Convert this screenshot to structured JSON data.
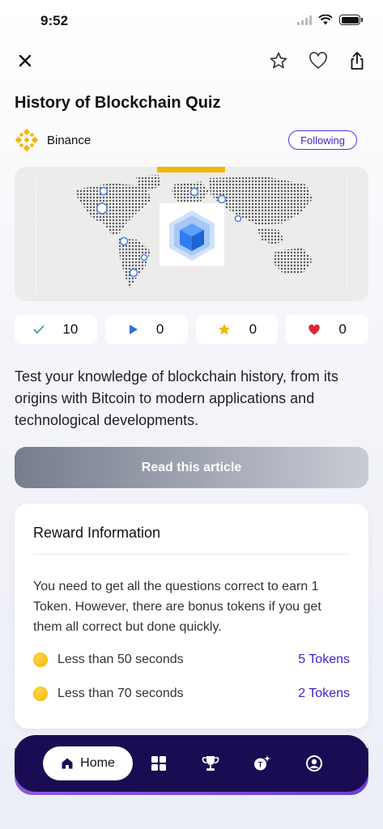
{
  "status": {
    "time": "9:52"
  },
  "quiz": {
    "title": "History of Blockchain Quiz",
    "publisher": "Binance",
    "follow_label": "Following",
    "description": "Test your knowledge of blockchain history, from its origins with Bitcoin to modern applications and technological developments."
  },
  "stats": {
    "correct": "10",
    "plays": "0",
    "stars": "0",
    "likes": "0"
  },
  "read_button": "Read this article",
  "reward": {
    "title": "Reward Information",
    "text": "You need to get all the questions correct to earn 1 Token. However, there are bonus tokens if you get them all correct but done quickly.",
    "rows": [
      {
        "label": "Less than 50 seconds",
        "value": "5 Tokens"
      },
      {
        "label": "Less than 70 seconds",
        "value": "2 Tokens"
      }
    ]
  },
  "nav": {
    "home_label": "Home"
  },
  "colors": {
    "accent": "#3a24d6",
    "nav_bg": "#1a0c52",
    "binance": "#f0b90b",
    "cube": "#2f7df0"
  },
  "icons": [
    "close-icon",
    "star-outline-icon",
    "heart-outline-icon",
    "share-icon",
    "binance-logo-icon",
    "check-icon",
    "play-icon",
    "star-icon",
    "heart-icon",
    "home-icon",
    "grid-icon",
    "trophy-icon",
    "token-sparkle-icon",
    "profile-icon"
  ]
}
